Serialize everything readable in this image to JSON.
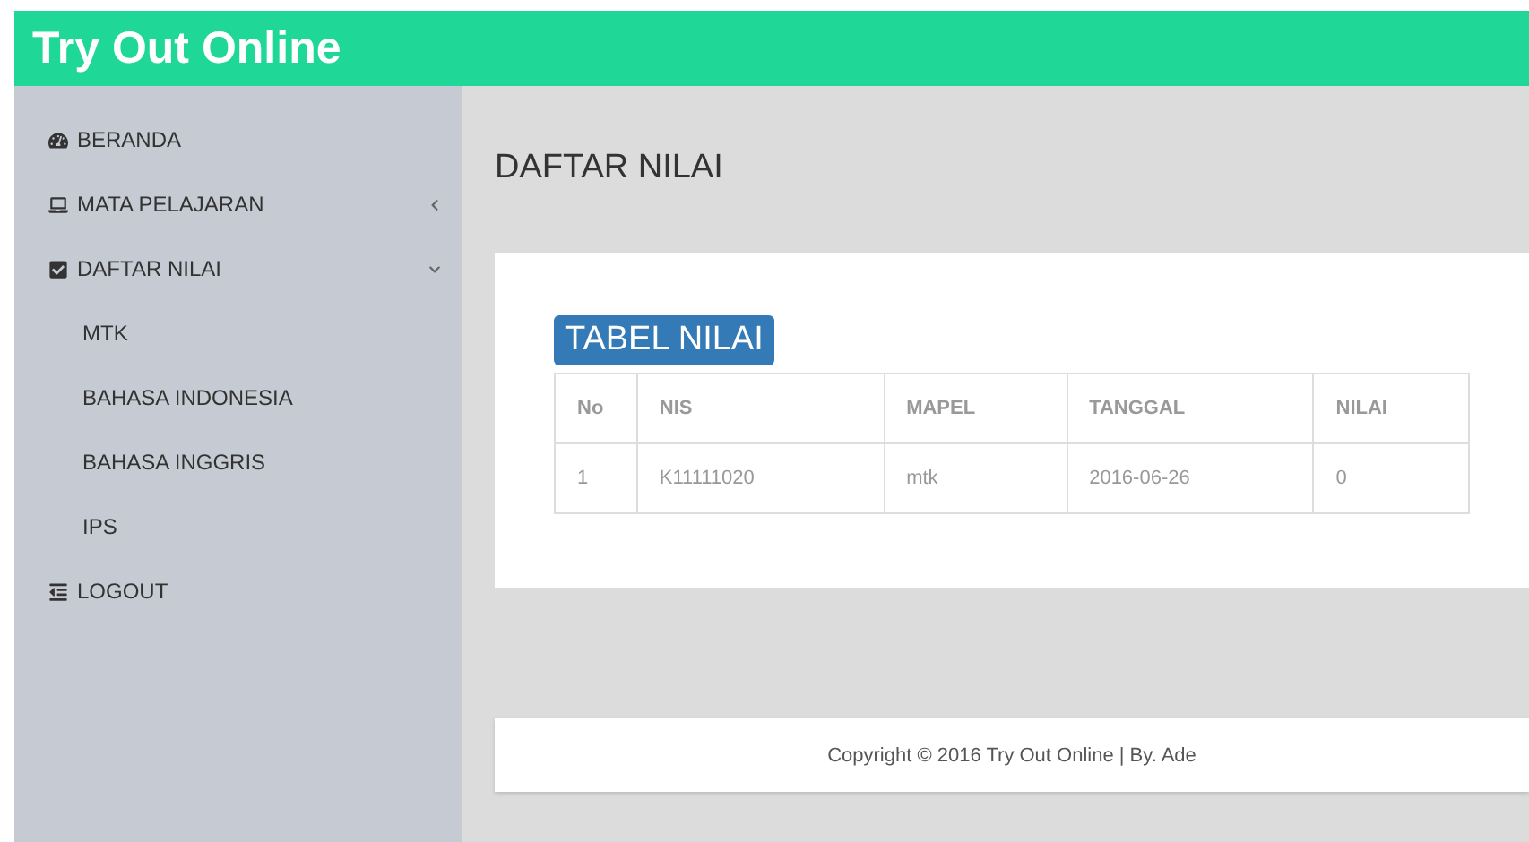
{
  "header": {
    "title": "Try Out Online"
  },
  "sidebar": {
    "items": [
      {
        "label": "BERANDA"
      },
      {
        "label": "MATA PELAJARAN",
        "expanded": false
      },
      {
        "label": "DAFTAR NILAI",
        "expanded": true,
        "children": [
          {
            "label": "MTK"
          },
          {
            "label": "BAHASA INDONESIA"
          },
          {
            "label": "BAHASA INGGRIS"
          },
          {
            "label": "IPS"
          }
        ]
      },
      {
        "label": "LOGOUT"
      }
    ]
  },
  "page_title": "DAFTAR NILAI",
  "panel": {
    "badge": "TABEL NILAI",
    "table": {
      "columns": [
        "No",
        "NIS",
        "MAPEL",
        "TANGGAL",
        "NILAI"
      ],
      "rows": [
        [
          "1",
          "K11111020",
          "mtk",
          "2016-06-26",
          "0"
        ]
      ]
    }
  },
  "footer": "Copyright © 2016 Try Out Online | By. Ade"
}
